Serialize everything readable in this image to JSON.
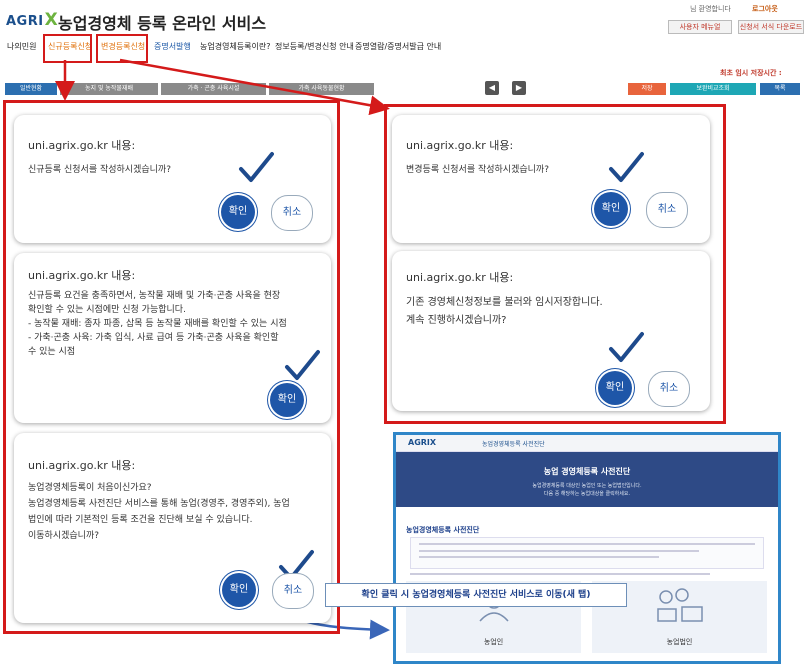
{
  "header": {
    "logo_text": "AGRI",
    "logo_x": "X",
    "title": "농업경영체 등록 온라인 서비스",
    "welcome": "님 환영합니다",
    "logout": "로그아웃",
    "manual": "사용자 메뉴얼",
    "download": "신청서 서식 다운로드"
  },
  "nav": {
    "items": [
      "나의민원",
      "신규등록신청",
      "변경등록신청",
      "증명서발행",
      "농업경영체등록이란?",
      "정보등록/변경신청 안내",
      "증명열람/증명서발급 안내"
    ]
  },
  "notice": "최초 임시 저장시간 :",
  "tabs": {
    "t1": "일반현황",
    "t2": "농지 및 농작물재배",
    "t3": "가축 · 곤충 사육시설",
    "t4": "가축 사육동물현황",
    "save": "저장",
    "compare": "보완비교조회",
    "list": "목록"
  },
  "dialogs": {
    "d1": {
      "title": "uni.agrix.go.kr 내용:",
      "msg": [
        "신규등록 신청서를 작성하시겠습니까?"
      ],
      "ok": "확인",
      "cancel": "취소"
    },
    "d2": {
      "title": "uni.agrix.go.kr 내용:",
      "msg": [
        "신규등록 요건을 충족하면서, 농작물 재배 및 가축·곤충 사육을 현장",
        "확인할 수 있는 시점에만 신청 가능합니다.",
        "- 농작물 재배: 종자 파종, 삽목 등 농작물 재배를 확인할 수 있는 시점",
        "- 가축·곤충 사육: 가축 입식, 사료 급여 등 가축·곤충 사육을 확인할",
        "수 있는 시점"
      ],
      "ok": "확인"
    },
    "d3": {
      "title": "uni.agrix.go.kr 내용:",
      "msg": [
        "농업경영체등록이 처음이신가요?",
        "농업경영체등록 사전진단 서비스를 통해 농업(경영주, 경영주외), 농업",
        "법인에 따라 기본적인 등록 조건을 진단해 보실 수 있습니다.",
        "이동하시겠습니까?"
      ],
      "ok": "확인",
      "cancel": "취소"
    },
    "d4": {
      "title": "uni.agrix.go.kr 내용:",
      "msg": [
        "변경등록 신청서를 작성하시겠습니까?"
      ],
      "ok": "확인",
      "cancel": "취소"
    },
    "d5": {
      "title": "uni.agrix.go.kr 내용:",
      "msg": [
        "기존 경영체신청정보를 불러와 임시저장합니다.",
        "계속 진행하시겠습니까?"
      ],
      "ok": "확인",
      "cancel": "취소"
    }
  },
  "preview": {
    "logo": "AGRIX",
    "header_text": "농업경영체등록 사전진단",
    "banner_title": "농업 경영체등록 사전진단",
    "banner_sub1": "농업경영체등록 대상인 농업인 또는 농업법인입니다.",
    "banner_sub2": "다음 중 해당하는 농업대상을 클릭하세요.",
    "section_title": "농업경영체등록 사전진단",
    "card1": "농업인",
    "card2": "농업법인"
  },
  "callout": "확인 클릭 시 농업경영체등록 사전진단 서비스로 이동(새 탭)",
  "colors": {
    "annotation_red": "#d41a1a",
    "preview_blue": "#2f86c8",
    "button_blue": "#1e56a8"
  }
}
